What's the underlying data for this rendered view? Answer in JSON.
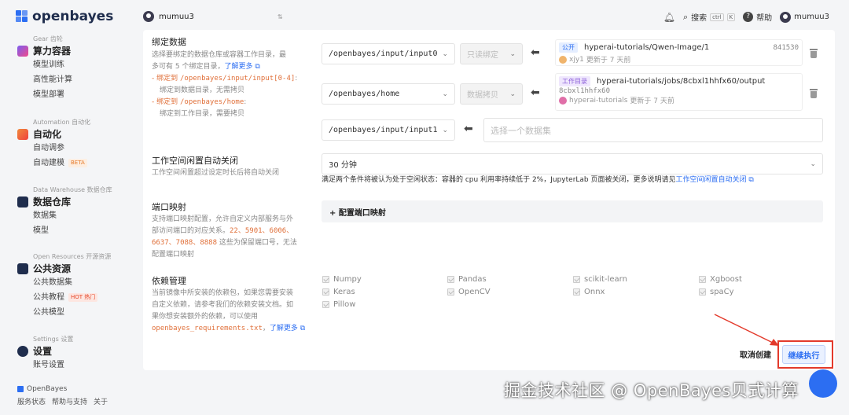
{
  "brand": {
    "name": "openbayes"
  },
  "topbar": {
    "user_select": "mumuu3",
    "search_label": "搜索",
    "search_kbd_1": "ctrl",
    "search_kbd_2": "K",
    "help_label": "帮助",
    "user_name": "mumuu3"
  },
  "sidebar": {
    "gear": {
      "sub": "Gear 齿轮",
      "title": "算力容器",
      "items": [
        "模型训练",
        "高性能计算",
        "模型部署"
      ]
    },
    "automation": {
      "sub": "Automation 自动化",
      "title": "自动化",
      "items": [
        "自动调参",
        "自动建模"
      ],
      "beta": "BETA"
    },
    "warehouse": {
      "sub": "Data Warehouse 数据仓库",
      "title": "数据仓库",
      "items": [
        "数据集",
        "模型"
      ]
    },
    "resources": {
      "sub": "Open Resources 开源资源",
      "title": "公共资源",
      "items": [
        "公共数据集",
        "公共教程",
        "公共模型"
      ],
      "hot": "HOT 热门"
    },
    "settings": {
      "sub": "Settings 设置",
      "title": "设置",
      "items": [
        "账号设置"
      ]
    },
    "footer": {
      "brand": "OpenBayes",
      "links": [
        "服务状态",
        "帮助与支持",
        "关于"
      ]
    }
  },
  "binding": {
    "title": "绑定数据",
    "desc_1": "选择要绑定的数据仓库或容器工作目录，最",
    "desc_2": "多可有 5 个绑定目录，",
    "desc_link": "了解更多",
    "rule_1_prefix": "- 绑定到 ",
    "rule_1_path": "/openbayes/input/input[0-4]",
    "rule_1_suffix": ":",
    "rule_1_desc": "绑定到数据目录，无需拷贝",
    "rule_2_prefix": "- 绑定到 ",
    "rule_2_path": "/openbayes/home",
    "rule_2_suffix": ":",
    "rule_2_desc": "绑定到工作目录，需要拷贝",
    "rows": [
      {
        "path": "/openbayes/input/input0",
        "mode": "只读绑定",
        "tag": "公开",
        "name": "hyperai-tutorials/Qwen-Image/1",
        "hash": "841530",
        "owner": "xjy1",
        "updated": "更新于 7 天前"
      },
      {
        "path": "/openbayes/home",
        "mode": "数据拷贝",
        "tag": "工作目录",
        "name": "hyperai-tutorials/jobs/8cbxl1hhfx60/output",
        "hash": "8cbxl1hhfx60",
        "owner": "hyperai-tutorials",
        "updated": "更新于 7 天前"
      },
      {
        "path": "/openbayes/input/input1",
        "placeholder": "选择一个数据集"
      }
    ]
  },
  "idle": {
    "title": "工作空间闲置自动关闭",
    "desc": "工作空间闲置超过设定时长后将自动关闭",
    "value": "30 分钟",
    "note": "满足两个条件将被认为处于空闲状态：容器的 cpu 利用率持续低于 2%，JupyterLab 页面被关闭，更多说明请见",
    "note_link": "工作空间闲置自动关闭"
  },
  "ports": {
    "title": "端口映射",
    "desc_1": "支持端口映射配置，允许自定义内部服务与外",
    "desc_2": "部访问端口的对应关系。",
    "ports_1": "22、5901、6006、",
    "ports_2": "6637、7088、8888",
    "desc_3": " 这些为保留端口号，无法",
    "desc_4": "配置端口映射",
    "config": "+ 配置端口映射"
  },
  "deps": {
    "title": "依赖管理",
    "desc_1": "当前镜像中所安装的依赖包，如果您需要安装",
    "desc_2": "自定义依赖，请参考我们的依赖安装文档。如",
    "desc_3": "果你想安装额外的依赖，可以使用",
    "file": "openbayes_requirements.txt",
    "desc_link": "了解更多",
    "packages": [
      "Numpy",
      "Pandas",
      "scikit-learn",
      "Xgboost",
      "Keras",
      "OpenCV",
      "Onnx",
      "spaCy",
      "Pillow"
    ]
  },
  "actions": {
    "cancel": "取消创建",
    "continue": "继续执行"
  },
  "watermark": "掘金技术社区 @ OpenBayes贝式计算",
  "colors": {
    "accent": "#2c6ef2",
    "highlight": "#e33a2b",
    "orange": "#e0703a"
  }
}
